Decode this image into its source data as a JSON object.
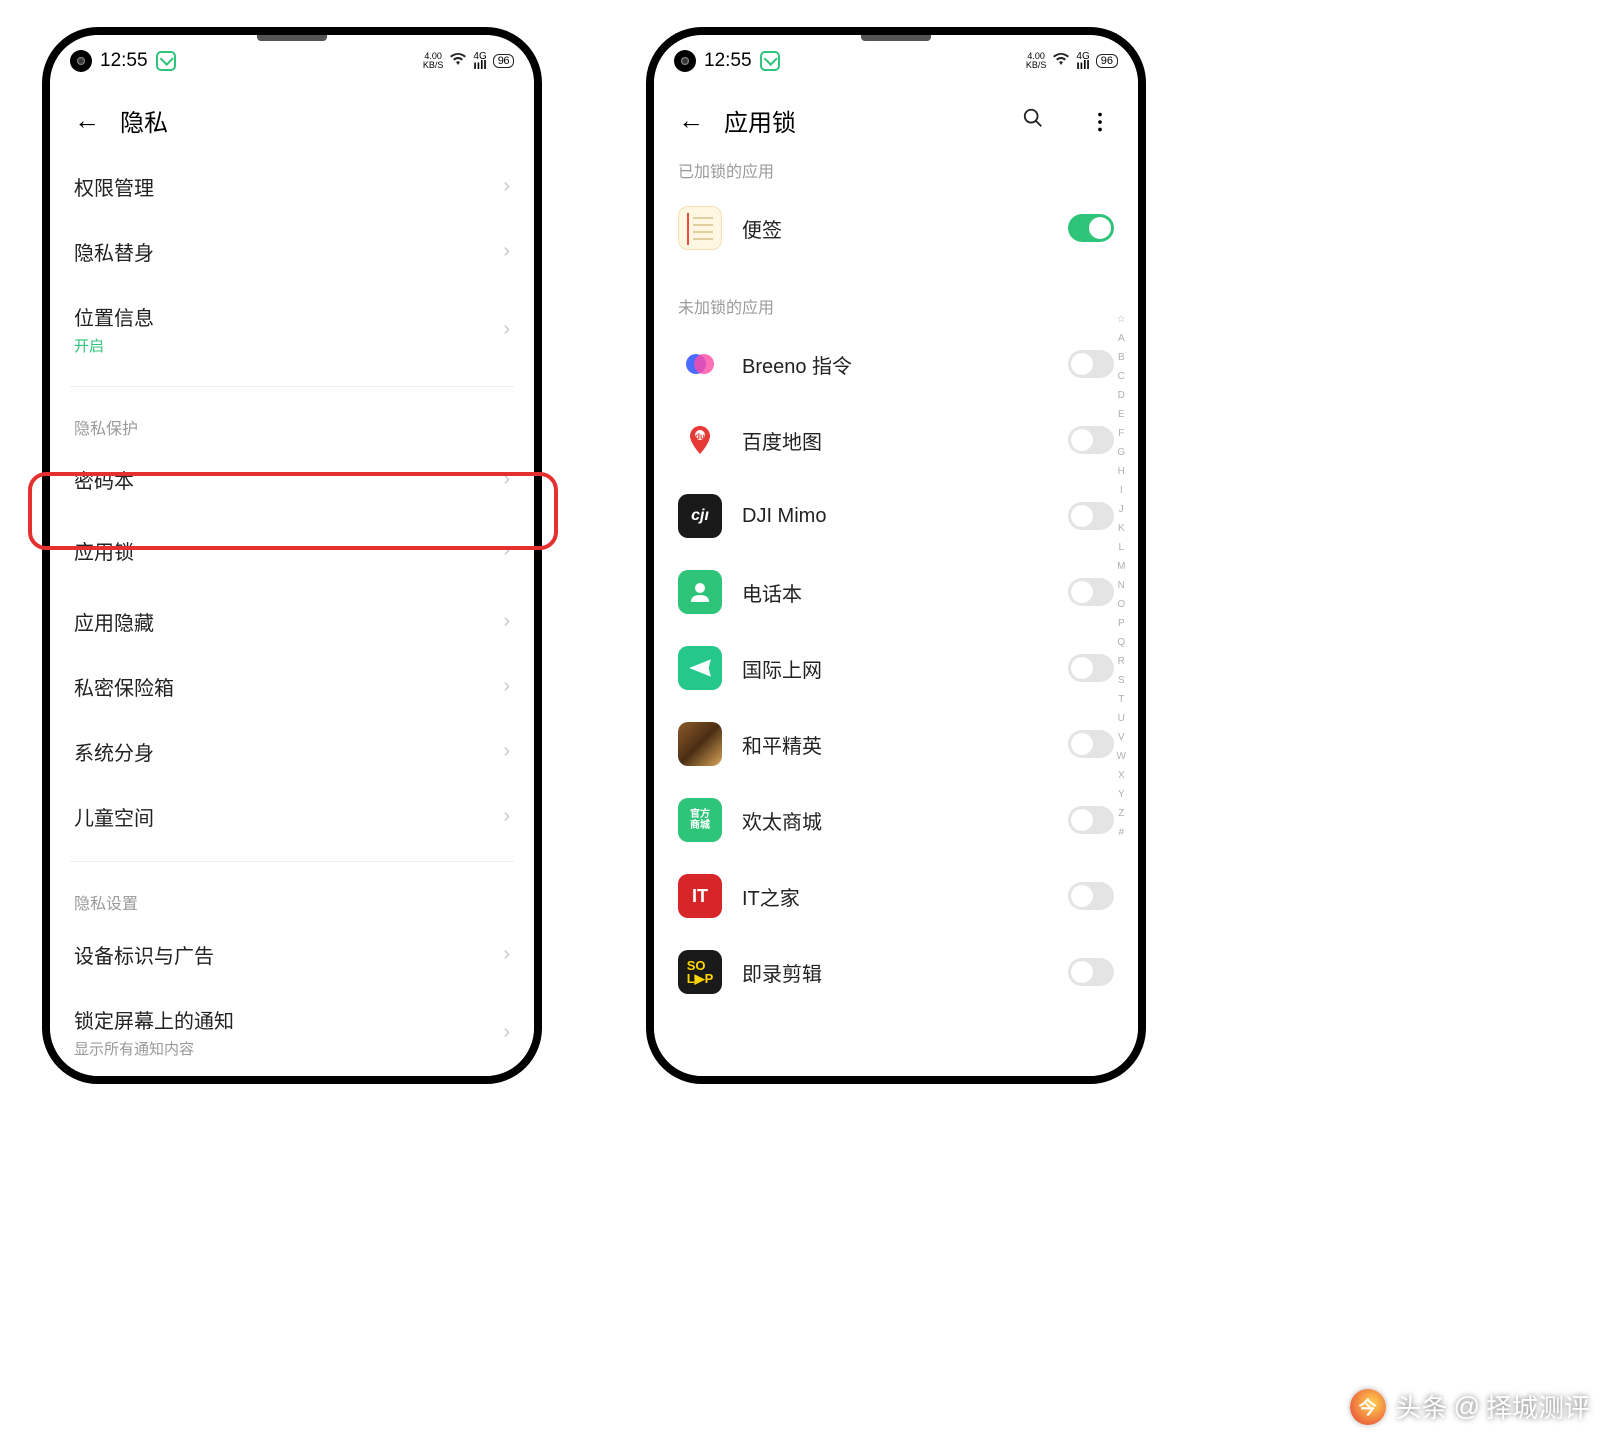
{
  "status": {
    "time": "12:55",
    "kbs_top": "4.00",
    "kbs_bot": "KB/S",
    "net": "4G",
    "batt": "96"
  },
  "left": {
    "title": "隐私",
    "rows": {
      "perm": "权限管理",
      "privsub": "隐私替身",
      "loc": "位置信息",
      "loc_sub": "开启",
      "sec1": "隐私保护",
      "pwbook": "密码本",
      "applock": "应用锁",
      "apphide": "应用隐藏",
      "safe": "私密保险箱",
      "clone": "系统分身",
      "child": "儿童空间",
      "sec2": "隐私设置",
      "adid": "设备标识与广告",
      "locknotif": "锁定屏幕上的通知",
      "locknotif_sub": "显示所有通知内容"
    }
  },
  "right": {
    "title": "应用锁",
    "locked_label": "已加锁的应用",
    "unlocked_label": "未加锁的应用",
    "locked": {
      "notes": "便签"
    },
    "apps": {
      "breeno": "Breeno 指令",
      "baidu": "百度地图",
      "dji": "DJI Mimo",
      "contacts": "电话本",
      "intl": "国际上网",
      "pubg": "和平精英",
      "huantai": "欢太商城",
      "ithome": "IT之家",
      "soloop": "即录剪辑"
    }
  },
  "alpha": [
    "☆",
    "A",
    "B",
    "C",
    "D",
    "E",
    "F",
    "G",
    "H",
    "I",
    "J",
    "K",
    "L",
    "M",
    "N",
    "O",
    "P",
    "Q",
    "R",
    "S",
    "T",
    "U",
    "V",
    "W",
    "X",
    "Y",
    "Z",
    "#"
  ],
  "watermark": {
    "brand": "头条",
    "at": "@",
    "name": "择城测评"
  }
}
